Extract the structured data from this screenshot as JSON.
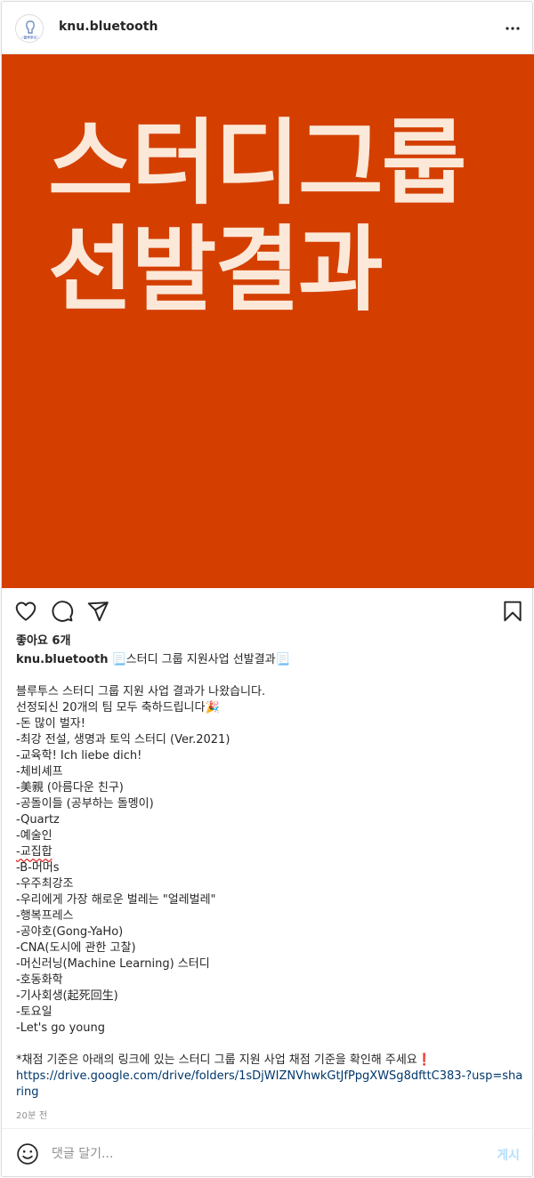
{
  "post": {
    "username": "knu.bluetooth",
    "avatar_text": "블루투스",
    "image": {
      "background_color": "#d43f00",
      "text_color": "#fbe8d8",
      "line1": "스터디그룹",
      "line2": "선발결과"
    },
    "likes": "좋아요 6개",
    "caption": {
      "author": "knu.bluetooth",
      "headline": "📃스터디 그룹 지원사업 선발결과📃",
      "lines": [
        "블루투스 스터디 그룹 지원 사업 결과가 나왔습니다.",
        "선정되신 20개의 팀 모두 축하드립니다🎉",
        "-돈 많이 벌자!",
        "-최강 전설, 생명과 토익 스터디 (Ver.2021)",
        "-교육학! Ich liebe dich!",
        "-체비셰프",
        "-美親 (아름다운 친구)",
        "-공돌이들 (공부하는 돌멩이)",
        "-Quartz",
        "-예술인",
        "-교집합",
        "-B-머머s",
        "-우주최강조",
        "-우리에게 가장 해로운 벌레는 \"얼레벌레\"",
        "-행복프레스",
        "-공야호(Gong-YaHo)",
        "-CNA(도시에 관한 고찰)",
        "-머신러닝(Machine Learning) 스터디",
        "-호동화학",
        "-기사회생(起死回生)",
        "-토요일",
        "-Let's go young"
      ],
      "note": "*채점 기준은 아래의 링크에 있는 스터디 그룹 지원 사업 채점 기준을 확인해 주세요❗",
      "link": "https://drive.google.com/drive/folders/1sDjWIZNVhwkGtJfPpgXWSg8dfttC383-?usp=sharing"
    },
    "timestamp": "20분 전"
  },
  "comment": {
    "placeholder": "댓글 달기...",
    "post_label": "게시"
  },
  "icons": {
    "more": "more-horizontal-icon",
    "like": "heart-icon",
    "comment": "comment-icon",
    "share": "paper-plane-icon",
    "save": "bookmark-icon",
    "emoji": "emoji-icon"
  },
  "colors": {
    "link": "#00376b",
    "post_button_disabled": "#b2dffc",
    "secondary_text": "#8e8e8e"
  }
}
